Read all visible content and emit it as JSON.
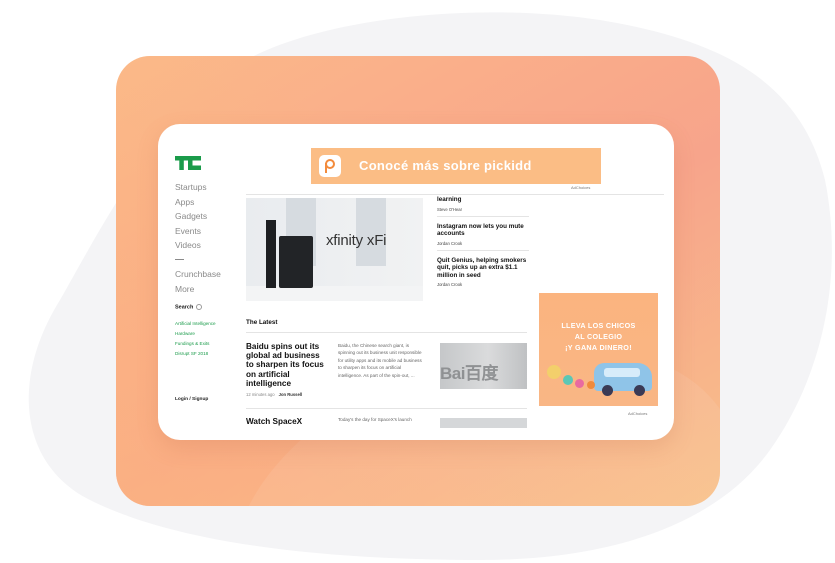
{
  "sidebar": {
    "nav": [
      "Startups",
      "Apps",
      "Gadgets",
      "Events",
      "Videos"
    ],
    "nav2": [
      "Crunchbase",
      "More"
    ],
    "search_label": "Search",
    "tags": [
      "Artificial Intelligence",
      "Hardware",
      "Fundings & Exits",
      "Disrupt SF 2018"
    ],
    "login": "Login / Signup"
  },
  "ads": {
    "top_text": "Conocé más sobre pickidd",
    "adchoices": "AdChoices",
    "side_lines": [
      "LLEVA LOS CHICOS",
      "AL COLEGIO",
      "¡Y GANA DINERO!"
    ]
  },
  "hero": {
    "brand": "xfinity xFi"
  },
  "side_stories": [
    {
      "title": "learning",
      "author": "Steve O'Hear"
    },
    {
      "title": "Instagram now lets you mute accounts",
      "author": "Jordan Crook"
    },
    {
      "title": "Quit Genius, helping smokers quit, picks up an extra $1.1 million in seed",
      "author": "Jordan Crook"
    }
  ],
  "latest": {
    "heading": "The Latest",
    "articles": [
      {
        "title": "Baidu spins out its global ad business to sharpen its focus on artificial intelligence",
        "time": "12 minutes ago",
        "author": "Jon Russell",
        "excerpt": "Baidu, the Chinese search giant, is spinning out its business unit responsible for utility apps and its mobile ad business to sharpen its focus on artificial intelligence. As part of the spin-out, ...",
        "image_text": "Bai百度"
      },
      {
        "title": "Watch SpaceX",
        "excerpt": "Today's the day for SpaceX's launch"
      }
    ]
  }
}
